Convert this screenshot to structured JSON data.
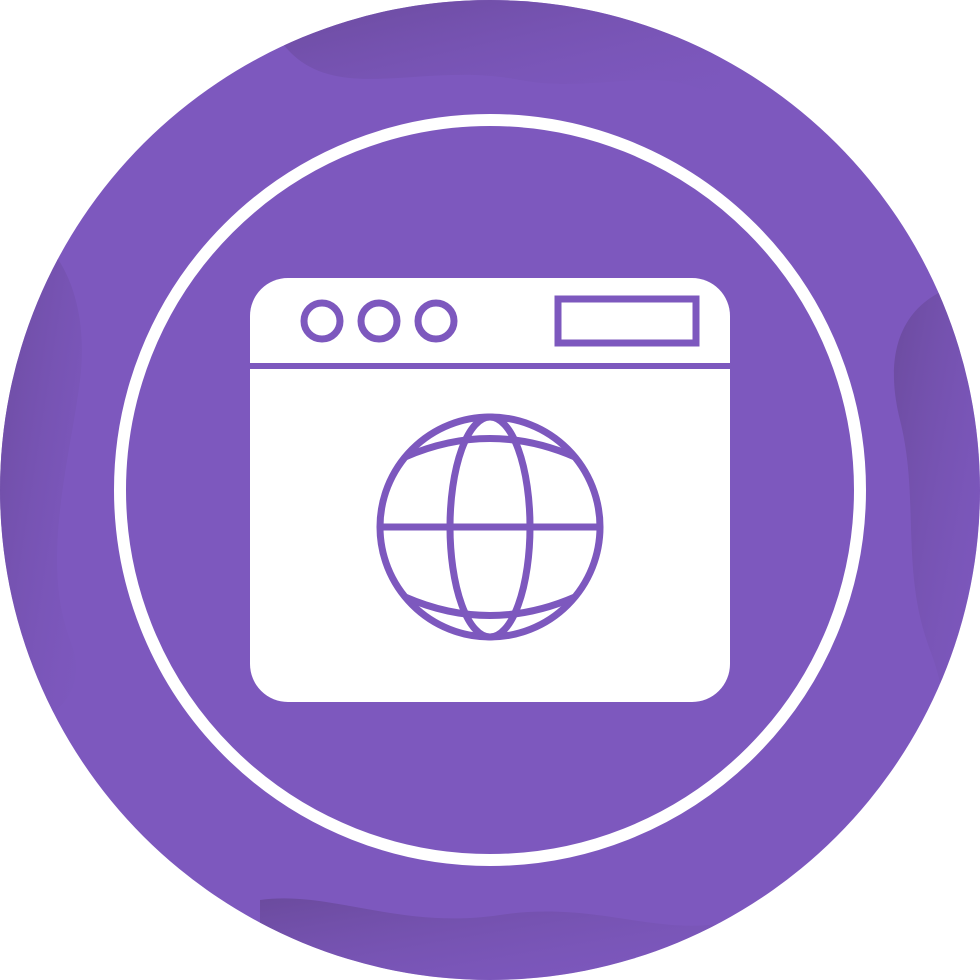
{
  "icon": {
    "name": "web-browser-globe-icon",
    "colors": {
      "background": "#ffffff",
      "circle": "#7d58be",
      "wave_shade": "#6a4a9c",
      "foreground": "#ffffff"
    },
    "window_control_dots": 3
  }
}
